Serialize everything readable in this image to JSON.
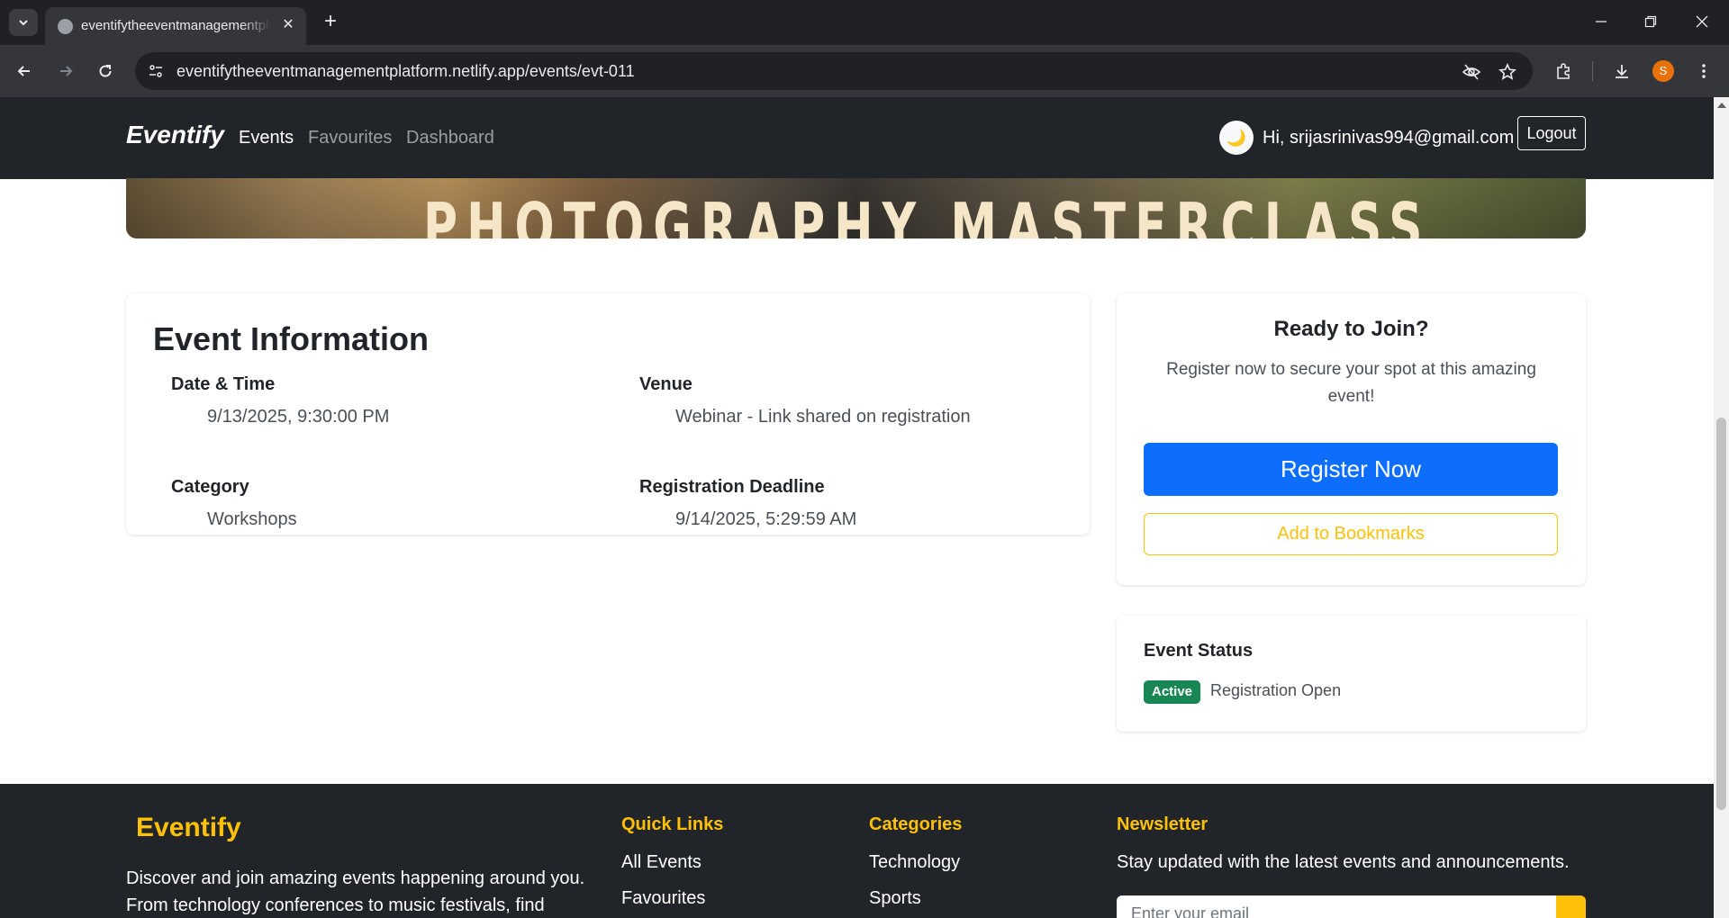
{
  "browser": {
    "tab_title": "eventifytheeventmanagementplatform.netlify.app/events/evt-011",
    "url": "eventifytheeventmanagementplatform.netlify.app/events/evt-011",
    "profile_initial": "S"
  },
  "navbar": {
    "brand": "Eventify",
    "links": [
      "Events",
      "Favourites",
      "Dashboard"
    ],
    "active_link": "Events",
    "avatar_emoji": "🌙",
    "greeting": "Hi, srijasrinivas994@gmail.com",
    "logout_label": "Logout"
  },
  "hero": {
    "title": "PHOTOGRAPHY MASTERCLASS"
  },
  "event_info": {
    "title": "Event Information",
    "fields": [
      {
        "label": "Date & Time",
        "value": "9/13/2025, 9:30:00 PM"
      },
      {
        "label": "Venue",
        "value": "Webinar - Link shared on registration"
      },
      {
        "label": "Category",
        "value": "Workshops"
      },
      {
        "label": "Registration Deadline",
        "value": "9/14/2025, 5:29:59 AM"
      }
    ]
  },
  "join": {
    "title": "Ready to Join?",
    "text": "Register now to secure your spot at this amazing event!",
    "register_label": "Register Now",
    "bookmark_label": "Add to Bookmarks"
  },
  "status": {
    "title": "Event Status",
    "badge": "Active",
    "text": "Registration Open"
  },
  "footer": {
    "brand": "Eventify",
    "description": "Discover and join amazing events happening around you. From technology conferences to music festivals, find",
    "quick_links_heading": "Quick Links",
    "quick_links": [
      "All Events",
      "Favourites"
    ],
    "categories_heading": "Categories",
    "categories": [
      "Technology",
      "Sports"
    ],
    "newsletter_heading": "Newsletter",
    "newsletter_text": "Stay updated with the latest events and announcements.",
    "email_placeholder": "Enter your email"
  },
  "colors": {
    "navbar_bg": "#212529",
    "primary": "#0d6efd",
    "warning": "#ffc107",
    "success": "#198754"
  }
}
